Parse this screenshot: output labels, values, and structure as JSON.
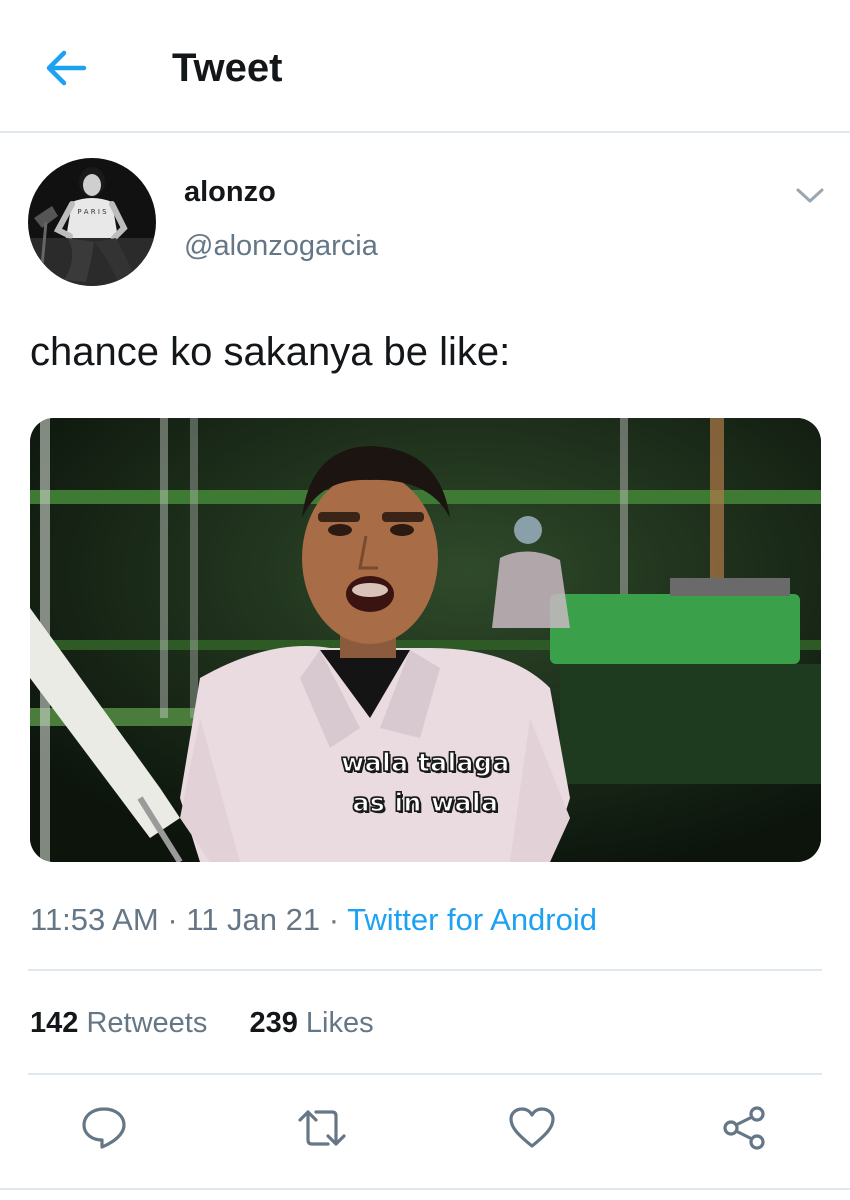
{
  "header": {
    "title": "Tweet",
    "back_icon": "arrow-left-icon"
  },
  "author": {
    "display_name": "alonzo",
    "handle": "@alonzogarcia",
    "avatar_icon": "avatar-photo"
  },
  "tweet": {
    "text": "chance ko sakanya be like:",
    "media": {
      "caption_line1": "wala talaga",
      "caption_line2": "as in wala"
    },
    "time": "11:53 AM",
    "date": "11 Jan 21",
    "separator": "·",
    "source": "Twitter for Android"
  },
  "stats": {
    "retweets_count": "142",
    "retweets_label": "Retweets",
    "likes_count": "239",
    "likes_label": "Likes"
  },
  "actions": {
    "reply_icon": "reply-icon",
    "retweet_icon": "retweet-icon",
    "like_icon": "heart-icon",
    "share_icon": "share-icon"
  },
  "colors": {
    "accent": "#1da1f2",
    "text_primary": "#14171a",
    "text_secondary": "#657786",
    "divider": "#e1e8ed"
  }
}
